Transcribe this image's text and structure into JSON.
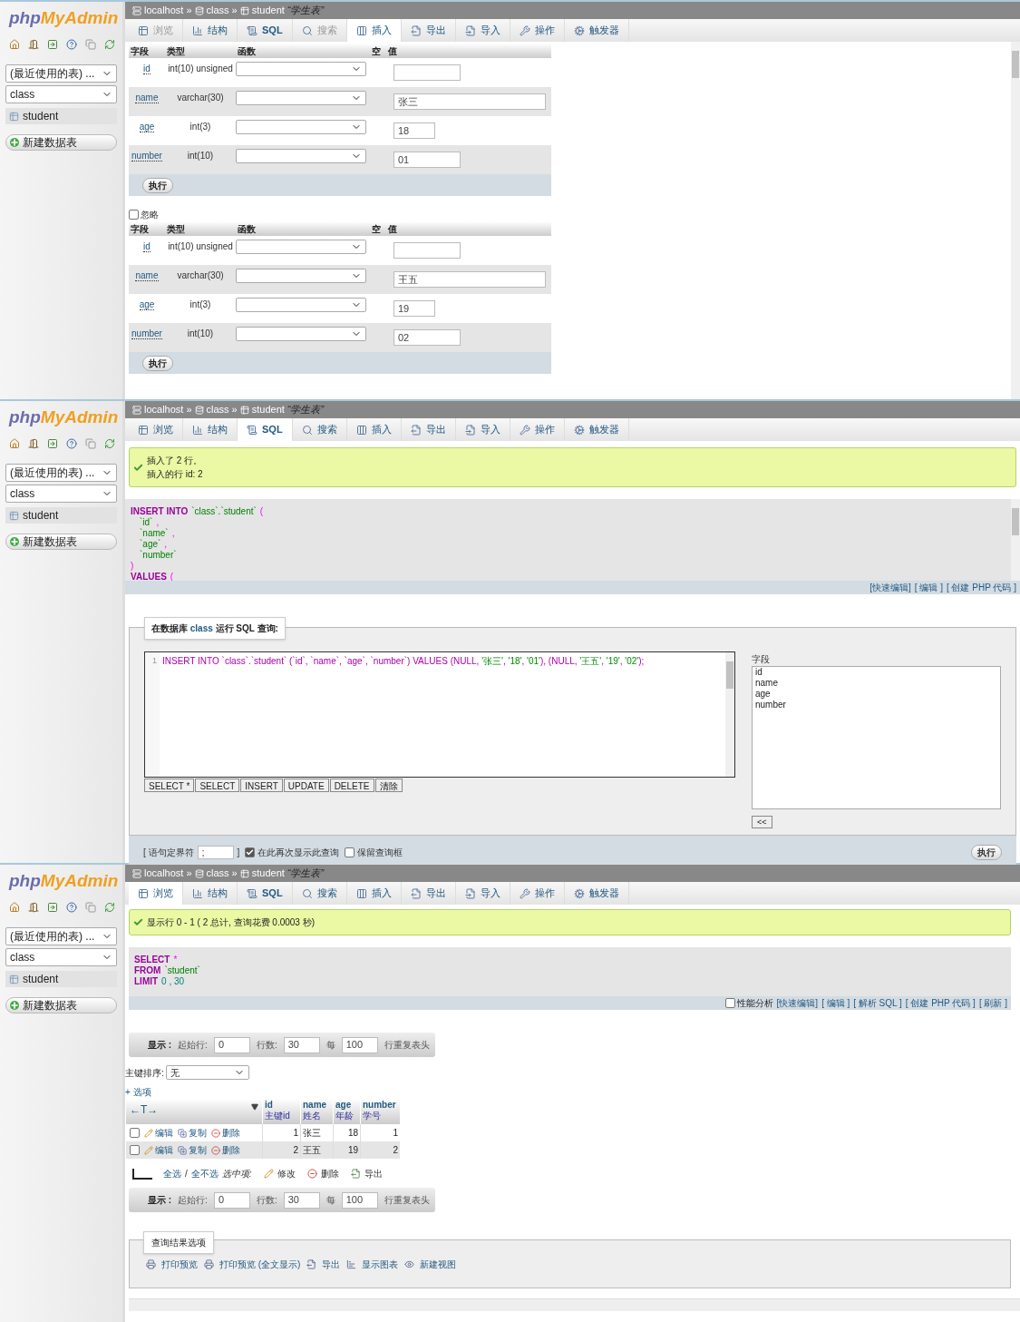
{
  "panels": [
    {
      "kind": "insert",
      "sidebar": {
        "logo": {
          "first": "php",
          "second": "MyAdmin"
        },
        "recent": "(最近使用的表) ...",
        "database": "class",
        "table": "student",
        "new_table": "新建数据表"
      },
      "breadcrumb": {
        "server": "localhost",
        "separator": "»",
        "database": "class",
        "table": "student",
        "comment": "“学生表”"
      },
      "tabs": [
        {
          "label": "浏览",
          "selected": false,
          "disabled": true
        },
        {
          "label": "结构",
          "selected": false,
          "disabled": false
        },
        {
          "label": "SQL",
          "selected": false,
          "disabled": false
        },
        {
          "label": "搜索",
          "selected": false,
          "disabled": true
        },
        {
          "label": "插入",
          "selected": true,
          "disabled": false
        },
        {
          "label": "导出",
          "selected": false,
          "disabled": false
        },
        {
          "label": "导入",
          "selected": false,
          "disabled": false
        },
        {
          "label": "操作",
          "selected": false,
          "disabled": false
        },
        {
          "label": "触发器",
          "selected": false,
          "disabled": false
        }
      ],
      "forms": [
        {
          "columns": [
            "字段",
            "类型",
            "函数",
            "空",
            "值"
          ],
          "rows": [
            {
              "field": "id",
              "type": "int(10) unsigned"
            },
            {
              "field": "name",
              "type": "varchar(30)",
              "value": "张三"
            },
            {
              "field": "age",
              "type": "int(3)",
              "value": "18"
            },
            {
              "field": "number",
              "type": "int(10)",
              "value": "01"
            }
          ],
          "button": "执行"
        },
        {
          "ignore": {
            "label": "忽略",
            "checked": false
          },
          "columns": [
            "字段",
            "类型",
            "函数",
            "空",
            "值"
          ],
          "rows": [
            {
              "field": "id",
              "type": "int(10) unsigned"
            },
            {
              "field": "name",
              "type": "varchar(30)",
              "value": "王五"
            },
            {
              "field": "age",
              "type": "int(3)",
              "value": "19"
            },
            {
              "field": "number",
              "type": "int(10)",
              "value": "02"
            }
          ],
          "button": "执行"
        }
      ]
    },
    {
      "kind": "sql",
      "sidebar": {
        "logo": {
          "first": "php",
          "second": "MyAdmin"
        },
        "recent": "(最近使用的表) ...",
        "database": "class",
        "table": "student",
        "new_table": "新建数据表"
      },
      "breadcrumb": {
        "server": "localhost",
        "separator": "»",
        "database": "class",
        "table": "student",
        "comment": "“学生表”"
      },
      "tabs": [
        {
          "label": "浏览",
          "selected": false,
          "disabled": false
        },
        {
          "label": "结构",
          "selected": false,
          "disabled": false
        },
        {
          "label": "SQL",
          "selected": true,
          "disabled": false
        },
        {
          "label": "搜索",
          "selected": false,
          "disabled": false
        },
        {
          "label": "插入",
          "selected": false,
          "disabled": false
        },
        {
          "label": "导出",
          "selected": false,
          "disabled": false
        },
        {
          "label": "导入",
          "selected": false,
          "disabled": false
        },
        {
          "label": "操作",
          "selected": false,
          "disabled": false
        },
        {
          "label": "触发器",
          "selected": false,
          "disabled": false
        }
      ],
      "message": [
        "插入了 2 行。",
        "插入的行 id: 2"
      ],
      "sql_preview": [
        [
          {
            "t": "INSERT INTO",
            "kind": "keyword"
          },
          {
            "t": "`class`.`student`",
            "kind": "ident"
          },
          {
            "t": "(",
            "kind": "punct"
          }
        ],
        [
          {
            "t": "`id`",
            "kind": "ident"
          },
          {
            "t": ",",
            "kind": "punct"
          }
        ],
        [
          {
            "t": "`name`",
            "kind": "ident"
          },
          {
            "t": ",",
            "kind": "punct"
          }
        ],
        [
          {
            "t": "`age`",
            "kind": "ident"
          },
          {
            "t": ",",
            "kind": "punct"
          }
        ],
        [
          {
            "t": "`number`",
            "kind": "ident"
          }
        ],
        [
          {
            "t": ")",
            "kind": "punct"
          }
        ],
        [
          {
            "t": "VALUES",
            "kind": "keyword"
          },
          {
            "t": "(",
            "kind": "punct"
          }
        ]
      ],
      "links": [
        "[快速编辑]",
        "[ 编辑 ]",
        "[ 创建 PHP 代码 ]"
      ],
      "query_box": {
        "legend": "在数据库 **class** 运行 SQL 查询:",
        "line_number": "1",
        "code": [
          {
            "t": "INSERT INTO `class`.`student` (`id`, `name`, `age`, `number`) VALUES (NULL, ",
            "kind": "code"
          },
          {
            "t": "'张三'",
            "kind": "string"
          },
          {
            "t": ", ",
            "kind": "code"
          },
          {
            "t": "'18'",
            "kind": "string"
          },
          {
            "t": ", ",
            "kind": "code"
          },
          {
            "t": "'01'",
            "kind": "string"
          },
          {
            "t": "), (NULL, ",
            "kind": "code"
          },
          {
            "t": "'王五'",
            "kind": "string"
          },
          {
            "t": ", ",
            "kind": "code"
          },
          {
            "t": "'19'",
            "kind": "string"
          },
          {
            "t": ", ",
            "kind": "code"
          },
          {
            "t": "'02'",
            "kind": "string"
          },
          {
            "t": ");",
            "kind": "code"
          }
        ],
        "buttons": [
          "SELECT *",
          "SELECT",
          "INSERT",
          "UPDATE",
          "DELETE",
          "清除"
        ],
        "fields_label": "字段",
        "fields": [
          "id",
          "name",
          "age",
          "number"
        ],
        "insert_button": "<<"
      },
      "footer": {
        "delimiter_open": "[ 语句定界符",
        "delimiter": ";",
        "delimiter_close": "]",
        "options": [
          {
            "label": "在此再次显示此查询",
            "checked": true
          },
          {
            "label": "保留查询框",
            "checked": false
          }
        ],
        "button": "执行"
      }
    },
    {
      "kind": "browse",
      "sidebar": {
        "logo": {
          "first": "php",
          "second": "MyAdmin"
        },
        "recent": "(最近使用的表) ...",
        "database": "class",
        "table": "student",
        "new_table": "新建数据表"
      },
      "breadcrumb": {
        "server": "localhost",
        "separator": "»",
        "database": "class",
        "table": "student",
        "comment": "“学生表”"
      },
      "tabs": [
        {
          "label": "浏览",
          "selected": true,
          "disabled": false
        },
        {
          "label": "结构",
          "selected": false,
          "disabled": false
        },
        {
          "label": "SQL",
          "selected": false,
          "disabled": false
        },
        {
          "label": "搜索",
          "selected": false,
          "disabled": false
        },
        {
          "label": "插入",
          "selected": false,
          "disabled": false
        },
        {
          "label": "导出",
          "selected": false,
          "disabled": false
        },
        {
          "label": "导入",
          "selected": false,
          "disabled": false
        },
        {
          "label": "操作",
          "selected": false,
          "disabled": false
        },
        {
          "label": "触发器",
          "selected": false,
          "disabled": false
        }
      ],
      "message": [
        "显示行 0 - 1 ( 2 总计, 查询花费 0.0003 秒)"
      ],
      "sql_preview": [
        [
          {
            "t": "SELECT",
            "kind": "keyword"
          },
          {
            "t": "*",
            "kind": "punct"
          }
        ],
        [
          {
            "t": "FROM",
            "kind": "keyword"
          },
          {
            "t": "`student`",
            "kind": "ident"
          }
        ],
        [
          {
            "t": "LIMIT",
            "kind": "keyword"
          },
          {
            "t": "0 , 30",
            "kind": "number"
          }
        ]
      ],
      "profiling": {
        "label": "性能分析",
        "checked": false
      },
      "links": [
        "[快速编辑]",
        "[ 编辑 ]",
        "[ 解析 SQL ]",
        "[ 创建 PHP 代码 ]",
        "[ 刷新 ]"
      ],
      "navs": [
        {
          "show": "显示 :",
          "start_label": "起始行:",
          "start": "0",
          "rows_label": "行数:",
          "rows": "30",
          "every": "每",
          "repeat": "100",
          "repeat_label": "行重复表头"
        },
        {
          "show": "显示 :",
          "start_label": "起始行:",
          "start": "0",
          "rows_label": "行数:",
          "rows": "30",
          "every": "每",
          "repeat": "100",
          "repeat_label": "行重复表头"
        }
      ],
      "sort": {
        "label": "主键排序:",
        "value": "无"
      },
      "options": "+ 选项",
      "table": {
        "arrows": "←T→",
        "columns": [
          {
            "name": "id",
            "comment": "主键id"
          },
          {
            "name": "name",
            "comment": "姓名"
          },
          {
            "name": "age",
            "comment": "年龄"
          },
          {
            "name": "number",
            "comment": "学号"
          }
        ],
        "rows": [
          {
            "checked": false,
            "actions": [
              "编辑",
              "复制",
              "删除"
            ],
            "cells": [
              "1",
              "张三",
              "18",
              "1"
            ]
          },
          {
            "checked": false,
            "actions": [
              "编辑",
              "复制",
              "删除"
            ],
            "cells": [
              "2",
              "王五",
              "19",
              "2"
            ]
          }
        ]
      },
      "bulk": {
        "select_all": "全选",
        "slash": "/",
        "select_none": "全不选",
        "with_selected": "选中项:",
        "actions": [
          "修改",
          "删除",
          "导出"
        ]
      },
      "result_options": {
        "legend": "查询结果选项",
        "items": [
          "打印预览",
          "打印预览 (全文显示)",
          "导出",
          "显示图表",
          "新建视图"
        ]
      }
    }
  ]
}
